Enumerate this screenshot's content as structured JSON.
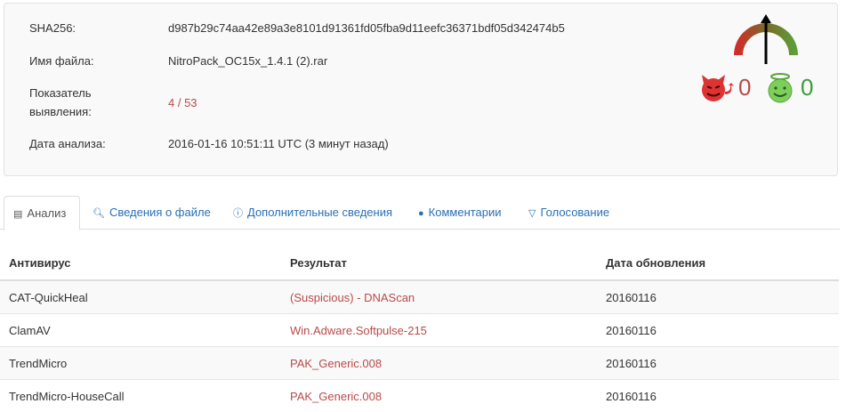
{
  "file_info": {
    "sha256_label": "SHA256:",
    "sha256_value": "d987b29c74aa42e89a3e8101d91361fd05fba9d11eefc36371bdf05d342474b5",
    "filename_label": "Имя файла:",
    "filename_value": "NitroPack_OC15x_1.4.1 (2).rar",
    "detection_label_line1": "Показатель",
    "detection_label_line2": "выявления:",
    "detection_value": "4 / 53",
    "date_label": "Дата анализа:",
    "date_value": "2016-01-16 10:51:11 UTC (3 минут назад)"
  },
  "votes": {
    "malicious_count": "0",
    "harmless_count": "0",
    "malicious_icon": "devil-icon",
    "harmless_icon": "angel-icon",
    "gauge_icon": "reputation-gauge-icon"
  },
  "tabs": [
    {
      "label": "Анализ",
      "icon": "table-icon",
      "active": true
    },
    {
      "label": "Сведения о файле",
      "icon": "search-icon",
      "active": false
    },
    {
      "label": "Дополнительные сведения",
      "icon": "info-icon",
      "active": false
    },
    {
      "label": "Комментарии",
      "icon": "comment-icon",
      "active": false
    },
    {
      "label": "Голосование",
      "icon": "thumbs-down-icon",
      "active": false
    }
  ],
  "table": {
    "headers": [
      "Антивирус",
      "Результат",
      "Дата обновления"
    ],
    "rows": [
      [
        "CAT-QuickHeal",
        "(Suspicious) - DNAScan",
        "20160116"
      ],
      [
        "ClamAV",
        "Win.Adware.Softpulse-215",
        "20160116"
      ],
      [
        "TrendMicro",
        "PAK_Generic.008",
        "20160116"
      ],
      [
        "TrendMicro-HouseCall",
        "PAK_Generic.008",
        "20160116"
      ]
    ]
  },
  "colors": {
    "link": "#2a6fb4",
    "detection_red": "#b94a48",
    "harmless_green": "#3c9d3c"
  }
}
